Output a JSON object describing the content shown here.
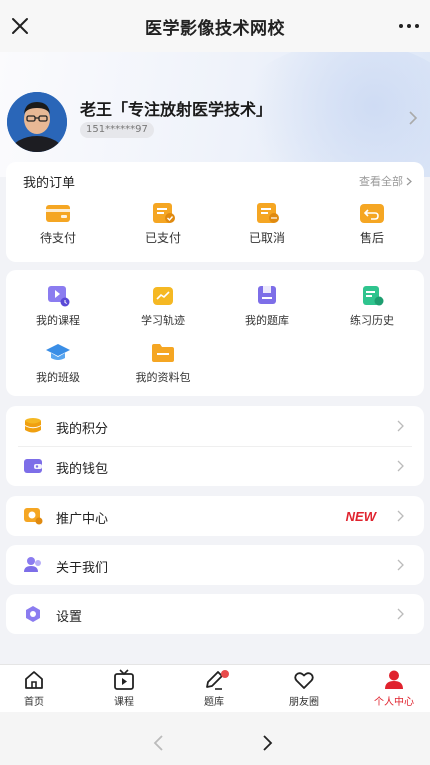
{
  "titlebar": {
    "title": "医学影像技术网校"
  },
  "profile": {
    "name": "老王「专注放射医学技术」",
    "phone": "151******97"
  },
  "orders": {
    "title": "我的订单",
    "view_all": "查看全部",
    "items": [
      {
        "label": "待支付",
        "icon": "wallet-icon"
      },
      {
        "label": "已支付",
        "icon": "paid-icon"
      },
      {
        "label": "已取消",
        "icon": "cancelled-icon"
      },
      {
        "label": "售后",
        "icon": "after-sales-icon"
      }
    ]
  },
  "tools": {
    "items": [
      {
        "label": "我的课程",
        "icon": "course-icon"
      },
      {
        "label": "学习轨迹",
        "icon": "trend-icon"
      },
      {
        "label": "我的题库",
        "icon": "question-bank-icon"
      },
      {
        "label": "练习历史",
        "icon": "history-icon"
      },
      {
        "label": "我的班级",
        "icon": "graduation-cap-icon"
      },
      {
        "label": "我的资料包",
        "icon": "folder-icon"
      }
    ]
  },
  "lists": {
    "points": "我的积分",
    "wallet": "我的钱包",
    "promotion": "推广中心",
    "promotion_badge": "NEW",
    "about": "关于我们",
    "settings": "设置"
  },
  "tabbar": {
    "items": [
      {
        "label": "首页",
        "icon": "home-icon"
      },
      {
        "label": "课程",
        "icon": "tv-play-icon"
      },
      {
        "label": "题库",
        "icon": "pencil-icon"
      },
      {
        "label": "朋友圈",
        "icon": "heart-icon"
      },
      {
        "label": "个人中心",
        "icon": "person-icon"
      }
    ],
    "active": "个人中心"
  },
  "colors": {
    "accent": "#e0232e",
    "orange": "#f5a623",
    "purple": "#7d6ee8",
    "green": "#2fc48e",
    "blue": "#3a8ee6"
  }
}
